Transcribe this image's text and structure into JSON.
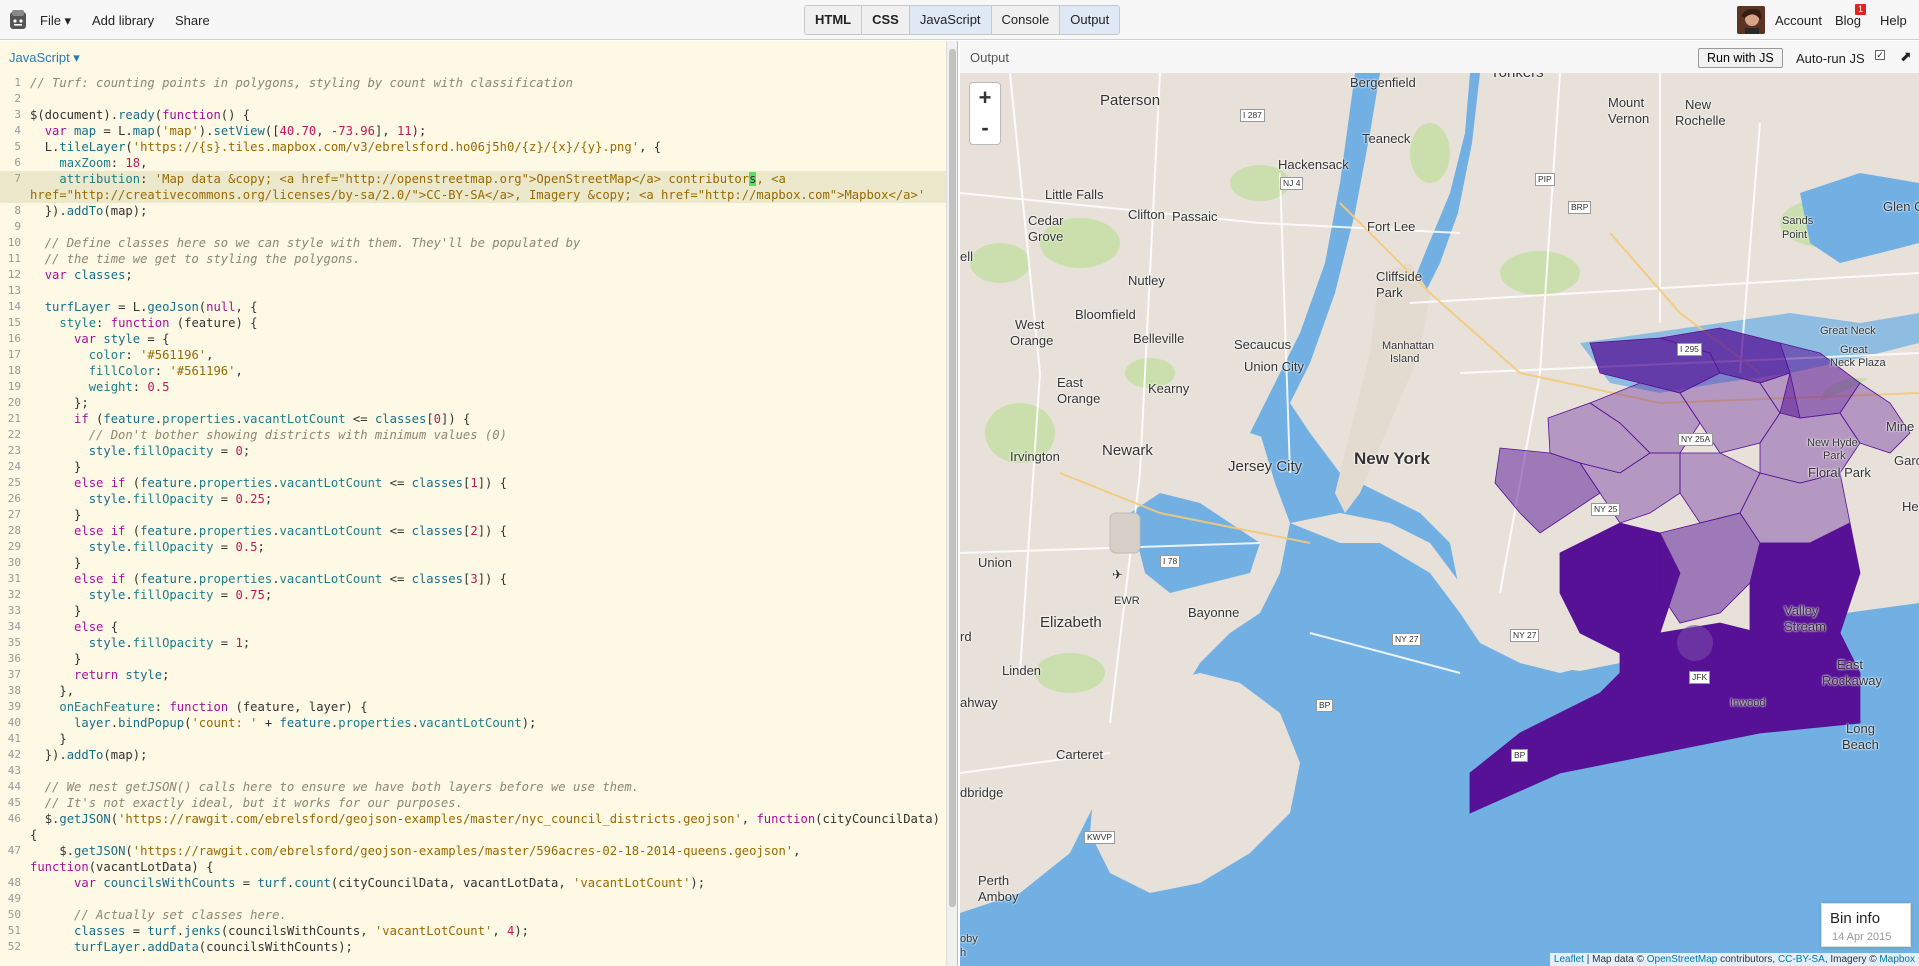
{
  "topbar": {
    "file": "File ▾",
    "add_library": "Add library",
    "share": "Share",
    "panels": [
      "HTML",
      "CSS",
      "JavaScript",
      "Console",
      "Output"
    ],
    "account": "Account",
    "blog": "Blog",
    "blog_badge": "1",
    "help": "Help"
  },
  "editor": {
    "label": "JavaScript ▾"
  },
  "output": {
    "label": "Output",
    "run_button": "Run with JS",
    "autorun_label": "Auto-run JS",
    "expand_icon": "expand-icon",
    "bin_info_title": "Bin info",
    "bin_info_date": "14 Apr 2015",
    "attribution": {
      "leaflet": "Leaflet",
      "sep": " | Map data © ",
      "osm": "OpenStreetMap",
      "contrib": " contributors, ",
      "license": "CC-BY-SA",
      "imagery": ", Imagery © ",
      "mapbox": "Mapbox"
    },
    "zoom_in": "+",
    "zoom_out": "-"
  },
  "map_labels": {
    "paterson": "Paterson",
    "bergenfield": "Bergenfield",
    "yonkers": "Yonkers",
    "mount_vernon_1": "Mount",
    "mount_vernon_2": "Vernon",
    "new_rochelle_1": "New",
    "new_rochelle_2": "Rochelle",
    "teaneck": "Teaneck",
    "hackensack": "Hackensack",
    "little_falls": "Little Falls",
    "cedar_grove_1": "Cedar",
    "cedar_grove_2": "Grove",
    "clifton": "Clifton",
    "passaic": "Passaic",
    "fort_lee": "Fort Lee",
    "sands_point_1": "Sands",
    "sands_point_2": "Point",
    "glen": "Glen C",
    "ell": "ell",
    "nutley": "Nutley",
    "cliffside_1": "Cliffside",
    "cliffside_2": "Park",
    "west_orange_1": "West",
    "west_orange_2": "Orange",
    "bloomfield": "Bloomfield",
    "belleville": "Belleville",
    "secaucus": "Secaucus",
    "manhattan_1": "Manhattan",
    "manhattan_2": "Island",
    "great_neck": "Great Neck",
    "great_neck_plaza_1": "Great",
    "great_neck_plaza_2": "Neck Plaza",
    "union_city": "Union City",
    "east_orange_1": "East",
    "east_orange_2": "Orange",
    "kearny": "Kearny",
    "mine": "Mine",
    "irvington": "Irvington",
    "newark": "Newark",
    "jersey_city": "Jersey City",
    "new_york": "New York",
    "new_hyde_park_1": "New Hyde",
    "new_hyde_park_2": "Park",
    "floral_park": "Floral Park",
    "garc": "Garc",
    "he": "He",
    "union": "Union",
    "ewr": "EWR",
    "elizabeth": "Elizabeth",
    "bayonne": "Bayonne",
    "valley_stream_1": "Valley",
    "valley_stream_2": "Stream",
    "east_rockaway_1": "East",
    "east_rockaway_2": "Rockaway",
    "inwood": "Inwood",
    "rd": "rd",
    "linden": "Linden",
    "ahway": "ahway",
    "carteret": "Carteret",
    "long_beach_1": "Long",
    "long_beach_2": "Beach",
    "dbridge": "dbridge",
    "perth_amboy_1": "Perth",
    "perth_amboy_2": "Amboy",
    "oby_1": "oby",
    "oby_2": "h",
    "shields": {
      "i287": "I 287",
      "nj4": "NJ 4",
      "pip": "PIP",
      "brp": "BRP",
      "i295": "I 295",
      "ny25a": "NY 25A",
      "ny25": "NY 25",
      "i78": "I 78",
      "ny27a": "NY 27",
      "ny27b": "NY 27",
      "bp": "BP",
      "bp2": "BP",
      "kwvp": "KWVP",
      "jfk": "JFK"
    }
  },
  "code_lines": [
    {
      "n": "1",
      "html": "<span class='cm'>// Turf: counting points in polygons, styling by count with classification</span>"
    },
    {
      "n": "2",
      "html": ""
    },
    {
      "n": "3",
      "html": "$(document).<span class='vr'>ready</span>(<span class='kw'>function</span>() {"
    },
    {
      "n": "4",
      "html": "  <span class='kw'>var</span> <span class='vr'>map</span> = L.<span class='vr'>map</span>(<span class='st'>'map'</span>).<span class='vr'>setView</span>([<span class='nu'>40.70</span>, <span class='nu'>-73.96</span>], <span class='nu'>11</span>);"
    },
    {
      "n": "5",
      "html": "  L.<span class='vr'>tileLayer</span>(<span class='st'>'https://{s}.tiles.mapbox.com/v3/ebrelsford.ho06j5h0/{z}/{x}/{y}.png'</span>, {"
    },
    {
      "n": "6",
      "html": "    <span class='pr'>maxZoom</span>: <span class='nu'>18</span>,"
    },
    {
      "n": "7",
      "hl": true,
      "html": "    <span class='pr'>attribution</span>: <span class='st'>'Map data &amp;copy; &lt;a href=\"http://openstreetmap.org\"&gt;OpenStreetMap&lt;/a&gt; contributor<span class='cursor'>s</span>, &lt;a href=\"http://creativecommons.org/licenses/by-sa/2.0/\"&gt;CC-BY-SA&lt;/a&gt;, Imagery &amp;copy; &lt;a href=\"http://mapbox.com\"&gt;Mapbox&lt;/a&gt;'</span>"
    },
    {
      "n": "8",
      "html": "  }).<span class='vr'>addTo</span>(map);"
    },
    {
      "n": "9",
      "html": ""
    },
    {
      "n": "10",
      "html": "  <span class='cm'>// Define classes here so we can style with them. They'll be populated by</span>"
    },
    {
      "n": "11",
      "html": "  <span class='cm'>// the time we get to styling the polygons.</span>"
    },
    {
      "n": "12",
      "html": "  <span class='kw'>var</span> <span class='vr'>classes</span>;"
    },
    {
      "n": "13",
      "html": ""
    },
    {
      "n": "14",
      "html": "  <span class='vr'>turfLayer</span> = L.<span class='vr'>geoJson</span>(<span class='kw'>null</span>, {"
    },
    {
      "n": "15",
      "html": "    <span class='pr'>style</span>: <span class='kw'>function</span> (feature) {"
    },
    {
      "n": "16",
      "html": "      <span class='kw'>var</span> <span class='vr'>style</span> = {"
    },
    {
      "n": "17",
      "html": "        <span class='pr'>color</span>: <span class='st'>'#561196'</span>,"
    },
    {
      "n": "18",
      "html": "        <span class='pr'>fillColor</span>: <span class='st'>'#561196'</span>,"
    },
    {
      "n": "19",
      "html": "        <span class='pr'>weight</span>: <span class='nu'>0.5</span>"
    },
    {
      "n": "20",
      "html": "      };"
    },
    {
      "n": "21",
      "html": "      <span class='kw'>if</span> (<span class='vr'>feature</span>.<span class='pr'>properties</span>.<span class='pr'>vacantLotCount</span> &lt;= <span class='vr'>classes</span>[<span class='nu'>0</span>]) {"
    },
    {
      "n": "22",
      "html": "        <span class='cm'>// Don't bother showing districts with minimum values (0)</span>"
    },
    {
      "n": "23",
      "html": "        <span class='vr'>style</span>.<span class='pr'>fillOpacity</span> = <span class='nu'>0</span>;"
    },
    {
      "n": "24",
      "html": "      }"
    },
    {
      "n": "25",
      "html": "      <span class='kw'>else if</span> (<span class='vr'>feature</span>.<span class='pr'>properties</span>.<span class='pr'>vacantLotCount</span> &lt;= <span class='vr'>classes</span>[<span class='nu'>1</span>]) {"
    },
    {
      "n": "26",
      "html": "        <span class='vr'>style</span>.<span class='pr'>fillOpacity</span> = <span class='nu'>0.25</span>;"
    },
    {
      "n": "27",
      "html": "      }"
    },
    {
      "n": "28",
      "html": "      <span class='kw'>else if</span> (<span class='vr'>feature</span>.<span class='pr'>properties</span>.<span class='pr'>vacantLotCount</span> &lt;= <span class='vr'>classes</span>[<span class='nu'>2</span>]) {"
    },
    {
      "n": "29",
      "html": "        <span class='vr'>style</span>.<span class='pr'>fillOpacity</span> = <span class='nu'>0.5</span>;"
    },
    {
      "n": "30",
      "html": "      }"
    },
    {
      "n": "31",
      "html": "      <span class='kw'>else if</span> (<span class='vr'>feature</span>.<span class='pr'>properties</span>.<span class='pr'>vacantLotCount</span> &lt;= <span class='vr'>classes</span>[<span class='nu'>3</span>]) {"
    },
    {
      "n": "32",
      "html": "        <span class='vr'>style</span>.<span class='pr'>fillOpacity</span> = <span class='nu'>0.75</span>;"
    },
    {
      "n": "33",
      "html": "      }"
    },
    {
      "n": "34",
      "html": "      <span class='kw'>else</span> {"
    },
    {
      "n": "35",
      "html": "        <span class='vr'>style</span>.<span class='pr'>fillOpacity</span> = <span class='nu'>1</span>;"
    },
    {
      "n": "36",
      "html": "      }"
    },
    {
      "n": "37",
      "html": "      <span class='kw'>return</span> <span class='vr'>style</span>;"
    },
    {
      "n": "38",
      "html": "    },"
    },
    {
      "n": "39",
      "html": "    <span class='pr'>onEachFeature</span>: <span class='kw'>function</span> (feature, layer) {"
    },
    {
      "n": "40",
      "html": "      <span class='vr'>layer</span>.<span class='vr'>bindPopup</span>(<span class='st'>'count: '</span> + <span class='vr'>feature</span>.<span class='pr'>properties</span>.<span class='pr'>vacantLotCount</span>);"
    },
    {
      "n": "41",
      "html": "    }"
    },
    {
      "n": "42",
      "html": "  }).<span class='vr'>addTo</span>(map);"
    },
    {
      "n": "43",
      "html": ""
    },
    {
      "n": "44",
      "html": "  <span class='cm'>// We nest getJSON() calls here to ensure we have both layers before we use them.</span>"
    },
    {
      "n": "45",
      "html": "  <span class='cm'>// It's not exactly ideal, but it works for our purposes.</span>"
    },
    {
      "n": "46",
      "html": "  $.<span class='vr'>getJSON</span>(<span class='st'>'https://rawgit.com/ebrelsford/geojson-examples/master/nyc_council_districts.geojson'</span>, <span class='kw'>function</span>(cityCouncilData) {"
    },
    {
      "n": "47",
      "html": "    $.<span class='vr'>getJSON</span>(<span class='st'>'https://rawgit.com/ebrelsford/geojson-examples/master/596acres-02-18-2014-queens.geojson'</span>, <span class='kw'>function</span>(vacantLotData) {"
    },
    {
      "n": "48",
      "html": "      <span class='kw'>var</span> <span class='vr'>councilsWithCounts</span> = <span class='vr'>turf</span>.<span class='vr'>count</span>(cityCouncilData, vacantLotData, <span class='st'>'vacantLotCount'</span>);"
    },
    {
      "n": "49",
      "html": ""
    },
    {
      "n": "50",
      "html": "      <span class='cm'>// Actually set classes here.</span>"
    },
    {
      "n": "51",
      "html": "      <span class='vr'>classes</span> = <span class='vr'>turf</span>.<span class='vr'>jenks</span>(councilsWithCounts, <span class='st'>'vacantLotCount'</span>, <span class='nu'>4</span>);"
    },
    {
      "n": "52",
      "html": "      <span class='vr'>turfLayer</span>.<span class='vr'>addData</span>(councilsWithCounts);"
    }
  ]
}
